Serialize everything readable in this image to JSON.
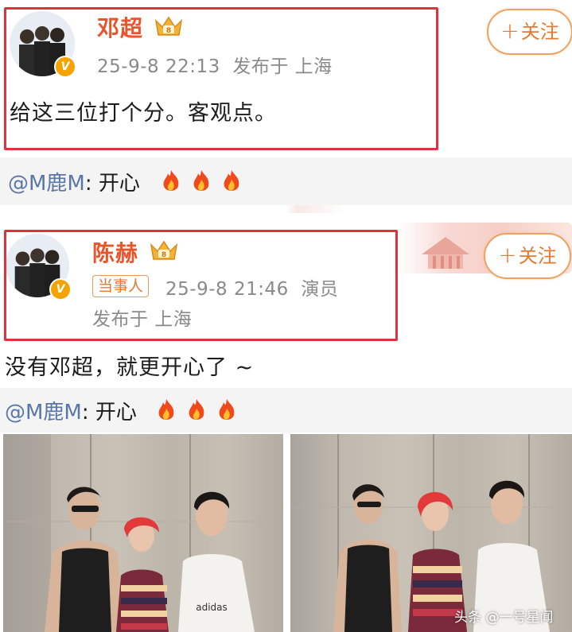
{
  "post1": {
    "author": "邓超",
    "meta": "25-9-8 22:13  发布于 上海",
    "text": "给这三位打个分。客观点。",
    "follow_label": "关注"
  },
  "reply1": {
    "mention": "@M鹿M",
    "text": ": 开心"
  },
  "post2": {
    "author": "陈赫",
    "tag": "当事人",
    "meta_line1": "25-9-8 21:46  演员",
    "meta_line2": "发布于 上海",
    "text": "没有邓超，就更开心了 ~",
    "follow_label": "关注"
  },
  "reply2": {
    "mention": "@M鹿M",
    "text": ": 开心"
  },
  "watermark": "头条 @一号星闻",
  "colors": {
    "author": "#e8542c",
    "highlight_box": "#e0323c",
    "follow": "#e8782c",
    "mention": "#5a76a8"
  },
  "icons": {
    "verified": "v-badge-icon",
    "crown": "crown-icon",
    "fire": "fire-icon"
  }
}
